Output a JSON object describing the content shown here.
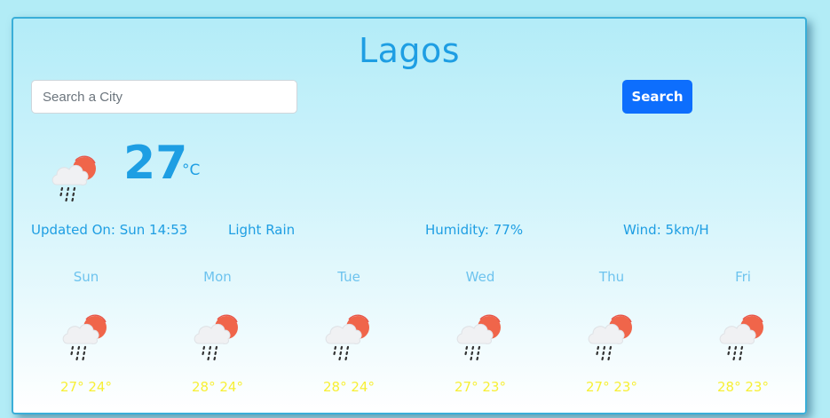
{
  "city": "Lagos",
  "search": {
    "placeholder": "Search a City",
    "value": "",
    "button_label": "Search"
  },
  "current": {
    "icon": "rain-cloud-sun-icon",
    "temperature": "27",
    "unit": "°C",
    "updated": "Updated On: Sun 14:53",
    "condition": "Light Rain",
    "humidity": "Humidity: 77%",
    "wind": "Wind: 5km/H"
  },
  "forecast": [
    {
      "day": "Sun",
      "temps": "27° 24°",
      "icon": "rain-cloud-sun-icon"
    },
    {
      "day": "Mon",
      "temps": "28° 24°",
      "icon": "rain-cloud-sun-icon"
    },
    {
      "day": "Tue",
      "temps": "28° 24°",
      "icon": "rain-cloud-sun-icon"
    },
    {
      "day": "Wed",
      "temps": "27° 23°",
      "icon": "rain-cloud-sun-icon"
    },
    {
      "day": "Thu",
      "temps": "27° 23°",
      "icon": "rain-cloud-sun-icon"
    },
    {
      "day": "Fri",
      "temps": "28° 23°",
      "icon": "rain-cloud-sun-icon"
    }
  ],
  "colors": {
    "accent": "#1e9ee3",
    "button": "#0d6efd",
    "day_label": "#6dc3ee",
    "forecast_temps": "#f7ef35",
    "sun": "#f0654a"
  }
}
